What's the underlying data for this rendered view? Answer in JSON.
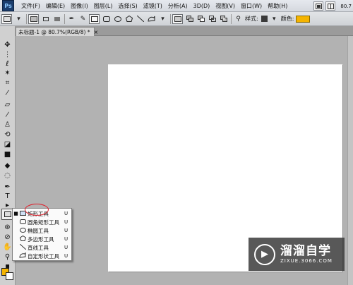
{
  "app": {
    "logo_text": "Ps",
    "zoom": "80.7"
  },
  "menu": [
    "文件(F)",
    "编辑(E)",
    "图像(I)",
    "图层(L)",
    "选择(S)",
    "滤镜(T)",
    "分析(A)",
    "3D(D)",
    "视图(V)",
    "窗口(W)",
    "帮助(H)"
  ],
  "options_bar": {
    "style_label": "样式:",
    "color_label": "颜色:"
  },
  "document_tab": {
    "title": "未标题-1 @ 80.7%(RGB/8) *",
    "close": "×"
  },
  "tool_flyout": {
    "items": [
      {
        "label": "矩形工具",
        "shortcut": "U",
        "icon": "rectangle-icon",
        "selected": true
      },
      {
        "label": "圆角矩形工具",
        "shortcut": "U",
        "icon": "rounded-rectangle-icon",
        "selected": false
      },
      {
        "label": "椭圆工具",
        "shortcut": "U",
        "icon": "ellipse-icon",
        "selected": false
      },
      {
        "label": "多边形工具",
        "shortcut": "U",
        "icon": "polygon-icon",
        "selected": false
      },
      {
        "label": "直线工具",
        "shortcut": "U",
        "icon": "line-icon",
        "selected": false
      },
      {
        "label": "自定形状工具",
        "shortcut": "U",
        "icon": "custom-shape-icon",
        "selected": false
      }
    ]
  },
  "colors": {
    "foreground": "#f5b400",
    "background": "#ffffff",
    "shape_color": "#f5b400",
    "highlight": "#e0202c"
  },
  "watermark": {
    "main": "溜溜自学",
    "sub": "ZIXUE.3066.COM"
  }
}
